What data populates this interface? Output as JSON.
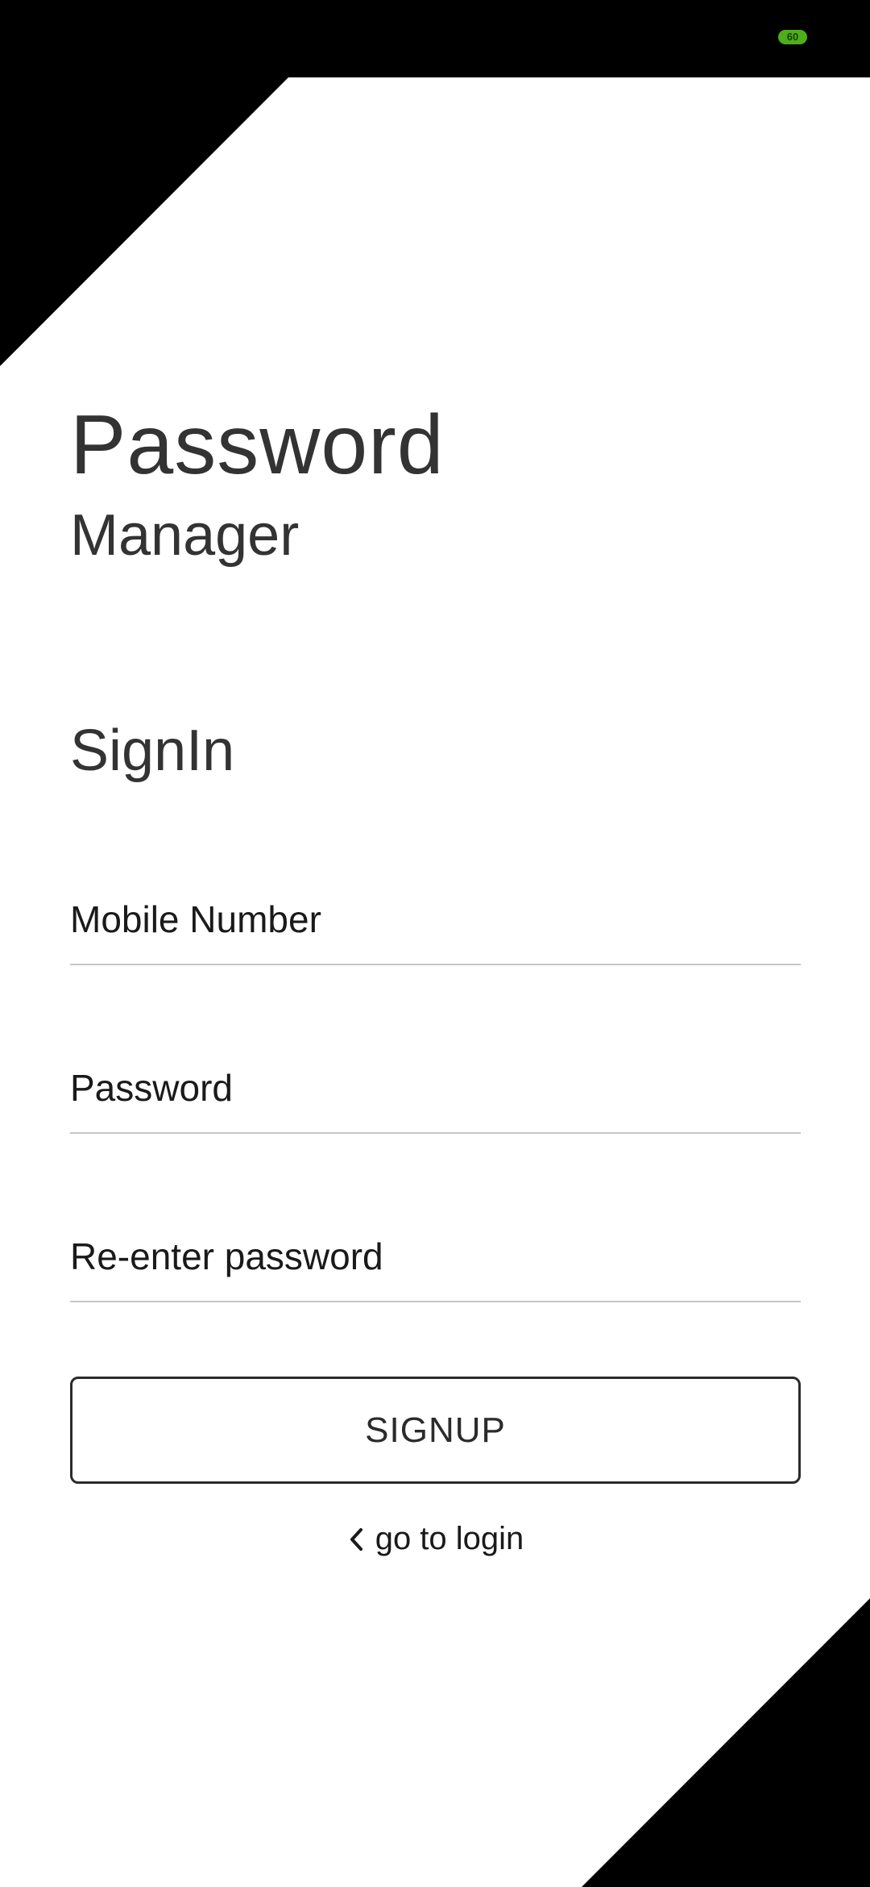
{
  "status_bar": {
    "battery_level": "60",
    "battery_color": "#4caf1a"
  },
  "header": {
    "title": "Password",
    "subtitle": "Manager"
  },
  "form": {
    "section_title": "SignIn",
    "mobile_placeholder": "Mobile Number",
    "mobile_value": "",
    "password_placeholder": "Password",
    "password_value": "",
    "repassword_placeholder": "Re-enter password",
    "repassword_value": "",
    "signup_label": "SIGNUP",
    "login_link_label": "go to login"
  },
  "icons": {
    "back": "chevron-left-icon"
  },
  "colors": {
    "background": "#ffffff",
    "decor": "#000000",
    "text": "#333333"
  }
}
